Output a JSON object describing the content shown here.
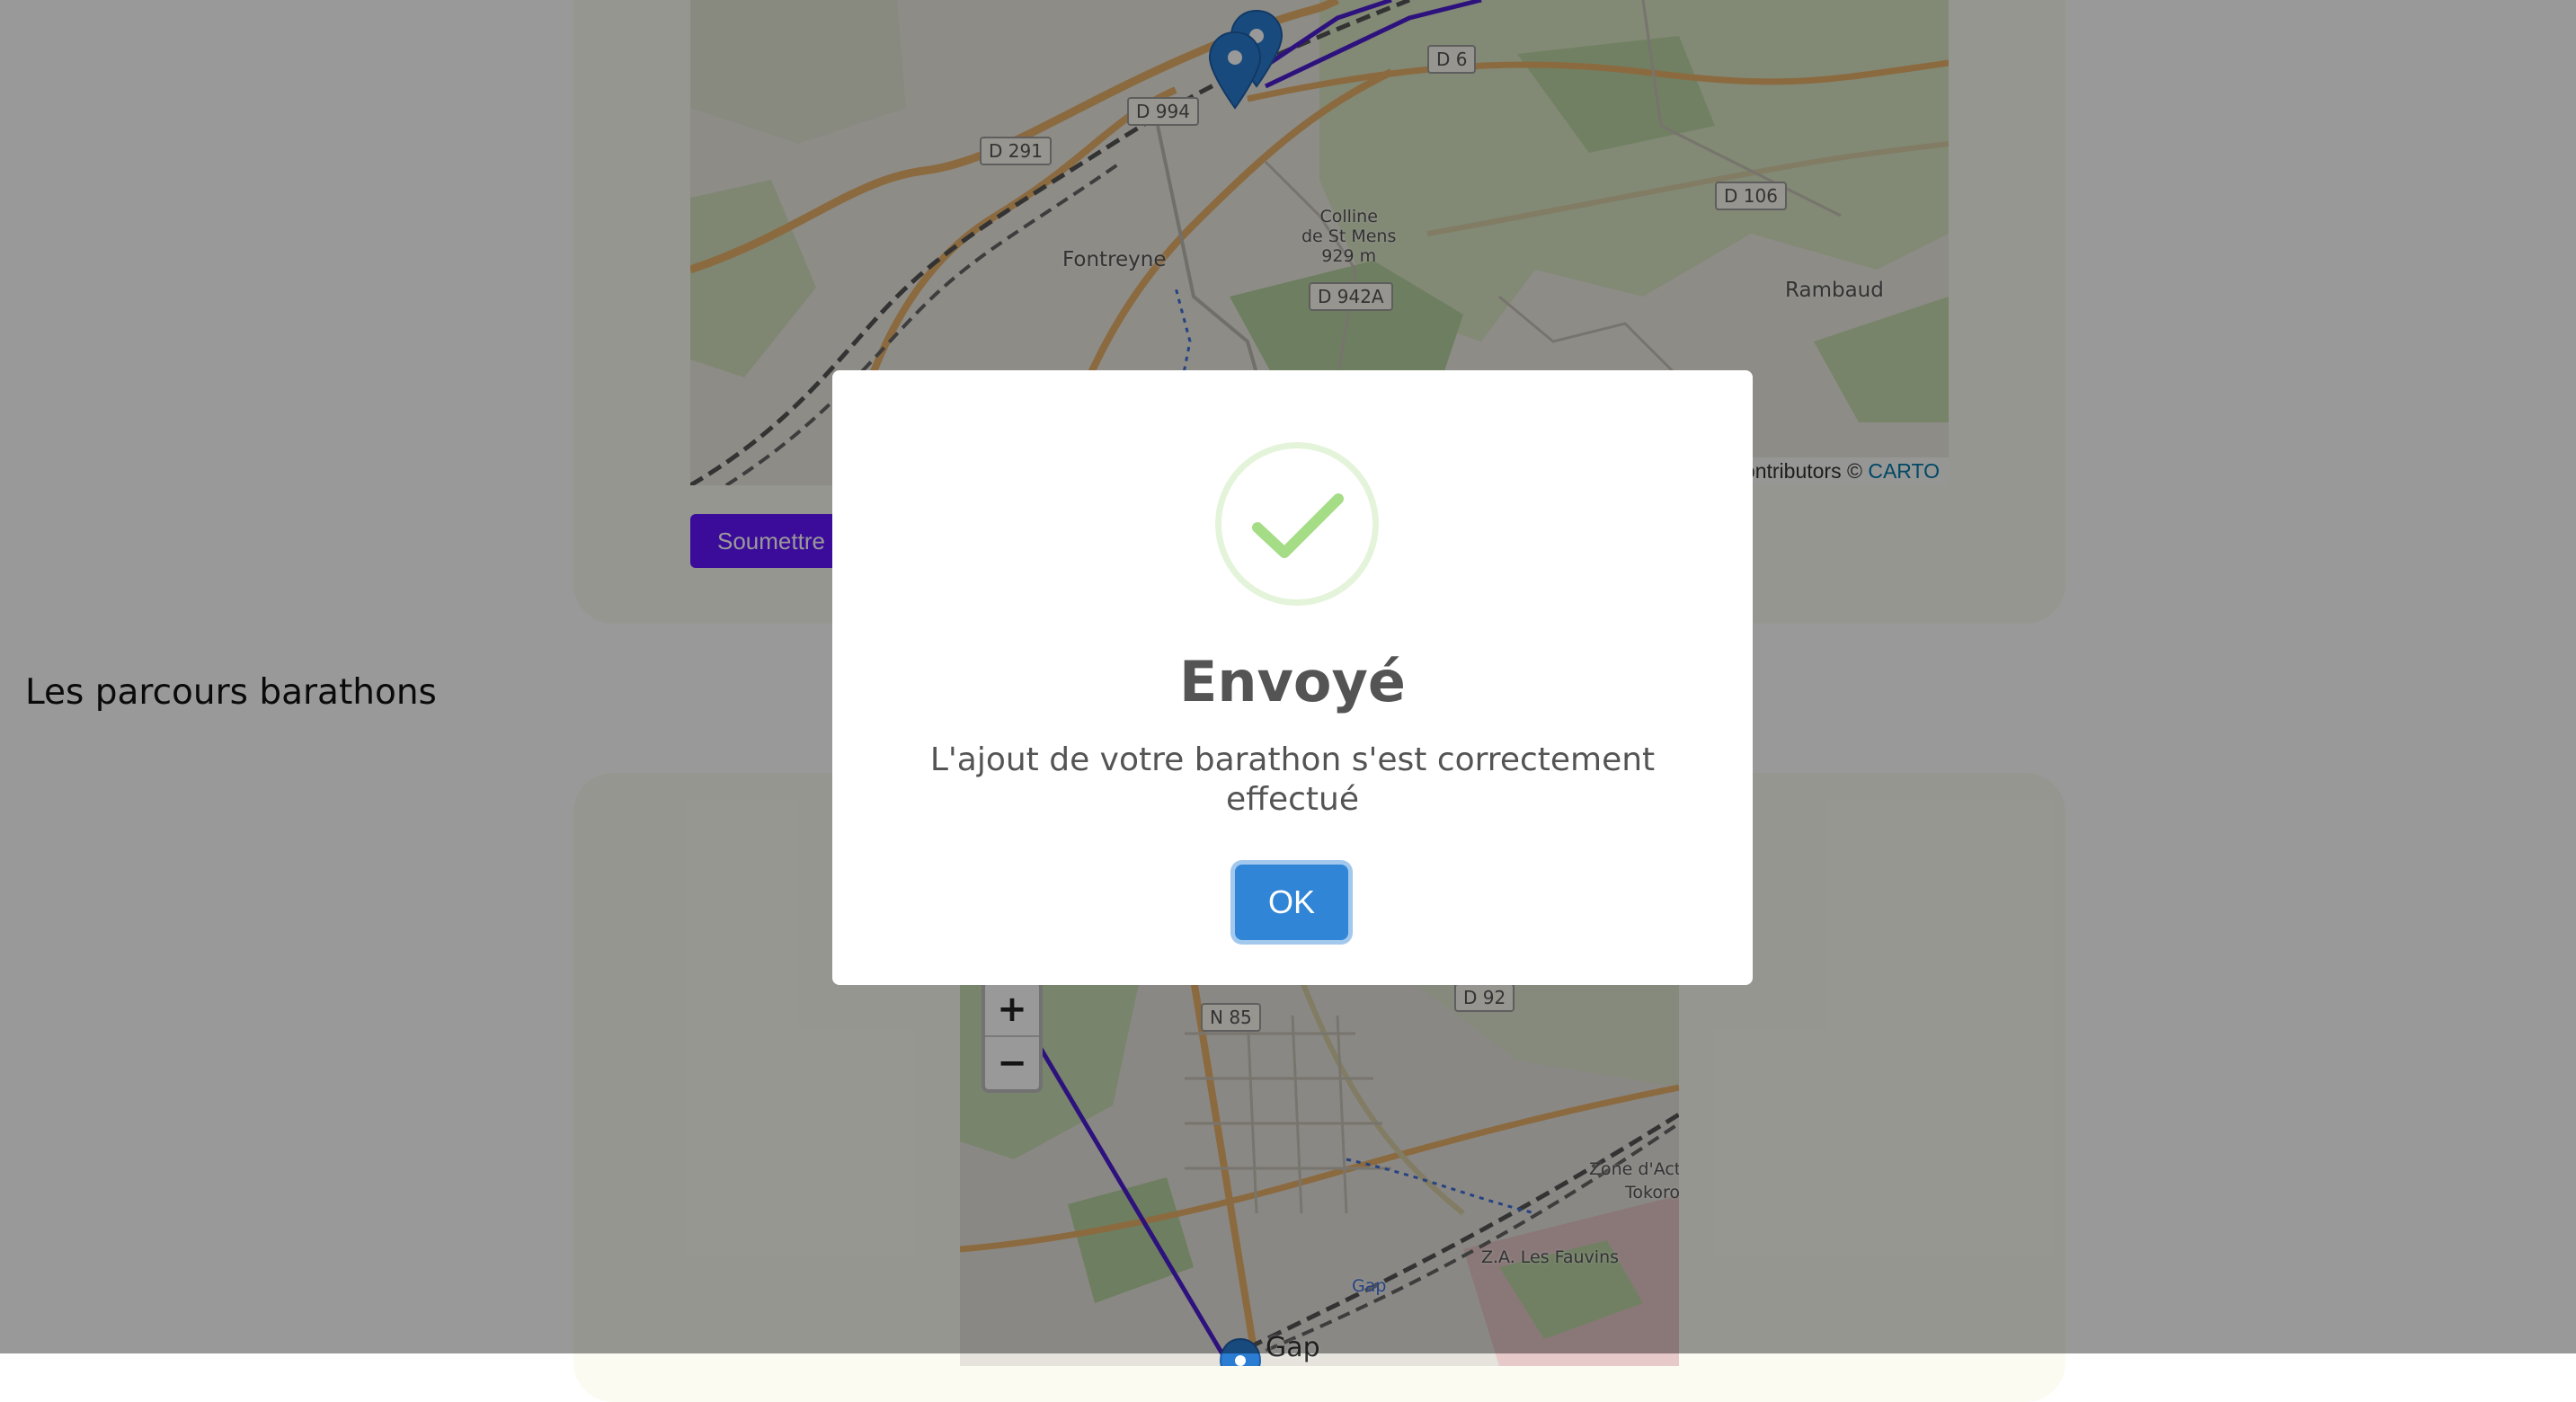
{
  "top_map": {
    "roads": [
      "D 6",
      "D 994",
      "D 291",
      "D 106",
      "D 942A"
    ],
    "places": [
      "Fontreyne",
      "Rambaud"
    ],
    "summit": "Colline\nde St Mens\n929 m",
    "attribution_prefix": "ontributors © ",
    "attribution_link": "CARTO"
  },
  "submit_label": "Soumettre",
  "section_heading": "Les parcours barathons",
  "bottom_map": {
    "roads": [
      "N 85",
      "D 92"
    ],
    "places": [
      "Zone d'Act",
      "Tokoro",
      "Z.A. Les Fauvins",
      "Gap",
      "Gap"
    ],
    "zoom_in": "+",
    "zoom_out": "−"
  },
  "modal": {
    "title": "Envoyé",
    "text": "L'ajout de votre barathon s'est correctement effectué",
    "ok_label": "OK"
  },
  "colors": {
    "route": "#4b1fd1",
    "marker": "#2b7cd3",
    "accent": "#6314ff",
    "ok_button": "#3085d6",
    "check": "#a5dc86"
  }
}
